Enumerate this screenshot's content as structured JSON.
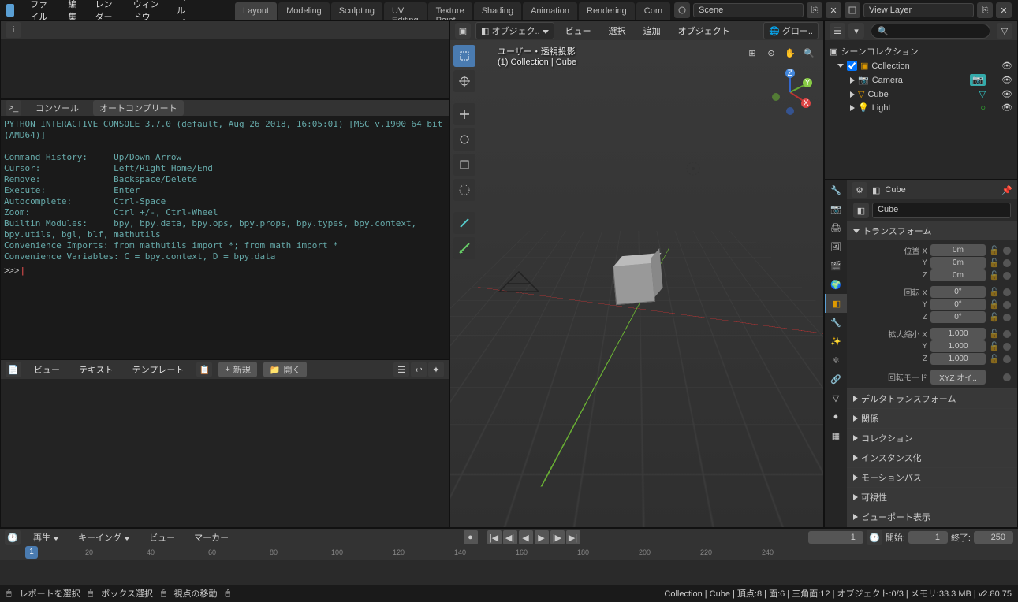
{
  "menu": {
    "file": "ファイル",
    "edit": "編集",
    "render": "レンダー",
    "window": "ウィンドウ",
    "help": "ヘルプ"
  },
  "workspaces": [
    "Layout",
    "Modeling",
    "Sculpting",
    "UV Editing",
    "Texture Paint",
    "Shading",
    "Animation",
    "Rendering",
    "Com"
  ],
  "workspace_active": 0,
  "scene": {
    "label": "Scene"
  },
  "viewlayer": {
    "label": "View Layer"
  },
  "console": {
    "tab_console": "コンソール",
    "tab_auto": "オートコンプリート",
    "text": "PYTHON INTERACTIVE CONSOLE 3.7.0 (default, Aug 26 2018, 16:05:01) [MSC v.1900 64 bit (AMD64)]\n\nCommand History:     Up/Down Arrow\nCursor:              Left/Right Home/End\nRemove:              Backspace/Delete\nExecute:             Enter\nAutocomplete:        Ctrl-Space\nZoom:                Ctrl +/-, Ctrl-Wheel\nBuiltin Modules:     bpy, bpy.data, bpy.ops, bpy.props, bpy.types, bpy.context, bpy.utils, bgl, blf, mathutils\nConvenience Imports: from mathutils import *; from math import *\nConvenience Variables: C = bpy.context, D = bpy.data\n",
    "prompt": ">>> "
  },
  "text_editor": {
    "view": "ビュー",
    "text": "テキスト",
    "template": "テンプレート",
    "new": "新規",
    "open": "開く"
  },
  "viewport": {
    "mode": "オブジェク..",
    "view": "ビュー",
    "select": "選択",
    "add": "追加",
    "object": "オブジェクト",
    "orient": "グロー..",
    "overlay1": "ユーザー・透視投影",
    "overlay2": "(1) Collection | Cube"
  },
  "outliner": {
    "scene_coll": "シーンコレクション",
    "collection": "Collection",
    "items": [
      {
        "name": "Camera"
      },
      {
        "name": "Cube"
      },
      {
        "name": "Light"
      }
    ]
  },
  "props": {
    "object_name": "Cube",
    "object_name2": "Cube",
    "transform": "トランスフォーム",
    "loc_label": "位置 X",
    "loc": [
      "0m",
      "0m",
      "0m"
    ],
    "rot_label": "回転 X",
    "rot": [
      "0°",
      "0°",
      "0°"
    ],
    "scale_label": "拡大縮小 X",
    "scale": [
      "1.000",
      "1.000",
      "1.000"
    ],
    "rot_mode_label": "回転モード",
    "rot_mode": "XYZ オイ..",
    "panels": [
      "デルタトランスフォーム",
      "関係",
      "コレクション",
      "インスタンス化",
      "モーションパス",
      "可視性",
      "ビューポート表示"
    ]
  },
  "timeline": {
    "play": "再生",
    "keying": "キーイング",
    "view": "ビュー",
    "marker": "マーカー",
    "current": "1",
    "start_label": "開始:",
    "start": "1",
    "end_label": "終了:",
    "end": "250",
    "marks": [
      20,
      40,
      60,
      80,
      100,
      120,
      140,
      160,
      180,
      200,
      220,
      240
    ],
    "playhead": "1"
  },
  "status": {
    "left1": "レポートを選択",
    "left2": "ボックス選択",
    "left3": "視点の移動",
    "right": "Collection | Cube | 頂点:8 | 面:6 | 三角面:12 | オブジェクト:0/3 | メモリ:33.3 MB | v2.80.75"
  }
}
